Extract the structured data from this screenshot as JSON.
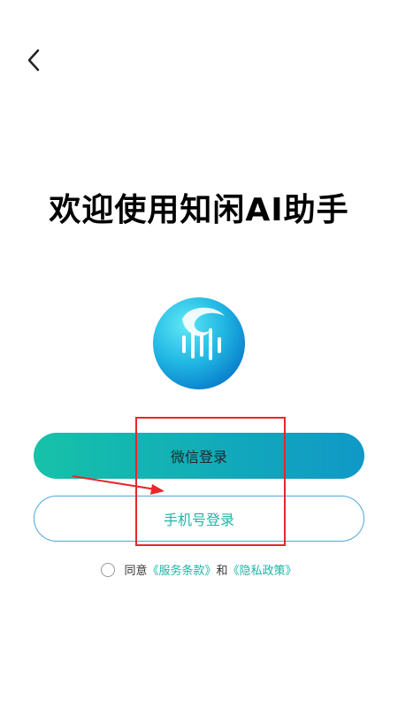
{
  "header": {
    "back_icon": "chevron-left-icon"
  },
  "welcome": {
    "title": "欢迎使用知闲AI助手"
  },
  "logo": {
    "icon": "app-logo-wave-icon",
    "colors": {
      "light": "#4fe0f0",
      "dark": "#0a8fd0"
    }
  },
  "actions": {
    "wechat_label": "微信登录",
    "phone_label": "手机号登录",
    "colors": {
      "gradient_start": "#16c2a8",
      "gradient_end": "#1098c7",
      "outline": "#4fa6e0",
      "accent_text": "#22b4a8"
    }
  },
  "agreement": {
    "prefix": "同意",
    "service_link": "《服务条款》",
    "connector": "和",
    "privacy_link": "《隐私政策》",
    "checked": false
  },
  "annotation": {
    "color": "#e8262b"
  }
}
